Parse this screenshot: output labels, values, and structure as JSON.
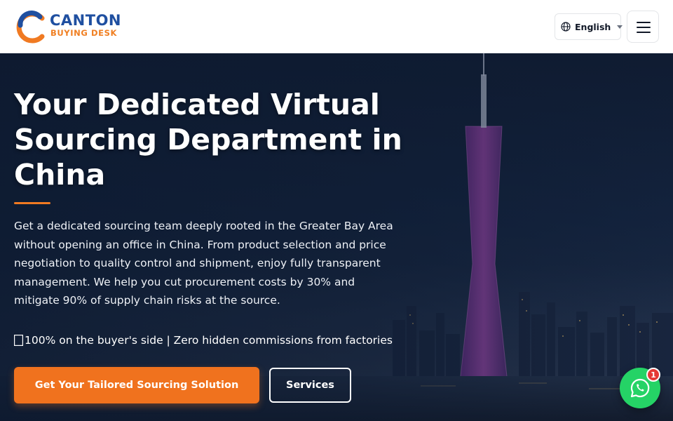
{
  "header": {
    "logo": {
      "line1": "CANTON",
      "line2": "BUYING DESK",
      "icon": "c-logo-icon"
    },
    "language": {
      "label": "English",
      "icon": "globe-icon"
    },
    "menu": {
      "icon": "hamburger-menu-icon"
    }
  },
  "hero": {
    "title": "Your Dedicated Virtual Sourcing Department in China",
    "description": "Get a dedicated sourcing team deeply rooted in the Greater Bay Area without opening an office in China. From product selection and price negotiation to quality control and shipment, enjoy fully transparent management. We help you cut procurement costs by 30% and mitigate 90% of supply chain risks at the source.",
    "guarantee": "100% on the buyer's side | Zero hidden commissions from factories",
    "guarantee_icon": "shield-icon",
    "cta_primary": "Get Your Tailored Sourcing Solution",
    "cta_secondary": "Services"
  },
  "whatsapp": {
    "badge": "1",
    "icon": "whatsapp-icon"
  },
  "colors": {
    "brand_blue": "#1f4fa0",
    "brand_orange": "#f07a22",
    "cta_orange": "#f0721e",
    "whatsapp_green": "#25d366"
  }
}
